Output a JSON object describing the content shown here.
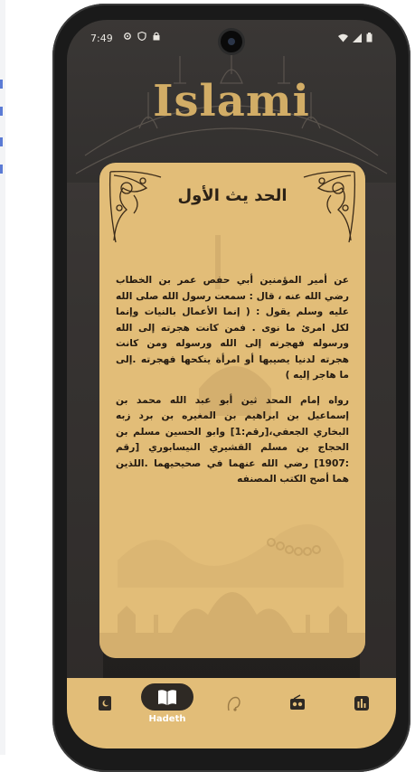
{
  "status_bar": {
    "time": "7:49",
    "left_icons": [
      "settings-icon",
      "shield-icon",
      "lock-icon"
    ],
    "right_icons": [
      "wifi-icon",
      "signal-icon",
      "battery-icon"
    ]
  },
  "app": {
    "logo_text": "Islami"
  },
  "hadith": {
    "title": "الحد يث الأول",
    "paragraph_1": "عن أمير المؤمنين أبي حفص عمر بن الخطاب رضي الله عنه ، قال : سمعت رسول الله صلى الله عليه وسلم يقول : ( إنما الأعمال بالنيات وإنما لكل امرئ ما نوى . فمن كانت هجرته إلى الله ورسوله فهجرته إلى الله ورسوله ومن كانت هجرته لدنيا يصيبها أو امرأة ينكحها فهجرته .إلى ما هاجر إليه )",
    "paragraph_2": "رواه إمام المحد ثين أبو عبد الله محمد بن إسماعيل بن ابراهيم بن المغيره بن برد زبه البخاري الجعفي،[رقم:1] وابو الحسين مسلم بن الحجاج بن مسلم القشيري النيسابوري [رقم :1907] رضي الله عنهما في صحيحيهما .اللذين هما أصح الكتب المصنفه"
  },
  "bottom_nav": {
    "items": [
      {
        "icon": "quran-icon",
        "label": ""
      },
      {
        "icon": "open-book-icon",
        "label": "Hadeth",
        "active": true
      },
      {
        "icon": "sebha-icon",
        "label": ""
      },
      {
        "icon": "radio-icon",
        "label": ""
      },
      {
        "icon": "time-bars-icon",
        "label": ""
      }
    ]
  },
  "colors": {
    "card": "#e2bd78",
    "logo": "#d2ad66",
    "nav_active": "#2e2924",
    "background": "#2c2a29"
  }
}
